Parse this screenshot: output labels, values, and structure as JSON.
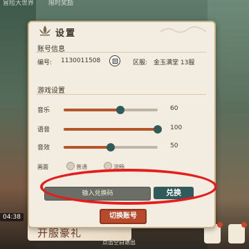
{
  "top_tabs": [
    "冒险大世界",
    "限时奖励"
  ],
  "bottom": {
    "timer": "04:38",
    "banner": "开服豪礼",
    "hint": "点击空白退出"
  },
  "settings": {
    "title": "设置",
    "account": {
      "section_label": "账号信息",
      "id_label": "编号:",
      "id_value": "1130011508",
      "server_label": "区服:",
      "server_value": "金玉满堂 13服"
    },
    "game": {
      "section_label": "游戏设置",
      "sliders": [
        {
          "label": "音乐",
          "value": 60,
          "percent": 60
        },
        {
          "label": "语音",
          "value": 100,
          "percent": 100
        },
        {
          "label": "音效",
          "value": 50,
          "percent": 50
        }
      ],
      "quality": {
        "label": "画面",
        "options": [
          "普通",
          "流畅"
        ]
      }
    },
    "redeem": {
      "placeholder": "输入兑换码",
      "button": "兑换"
    },
    "switch_account": "切换账号"
  },
  "colors": {
    "accent_red": "#b84a2b",
    "accent_teal": "#2f5b5a",
    "annotation_red": "#e21e1e"
  }
}
